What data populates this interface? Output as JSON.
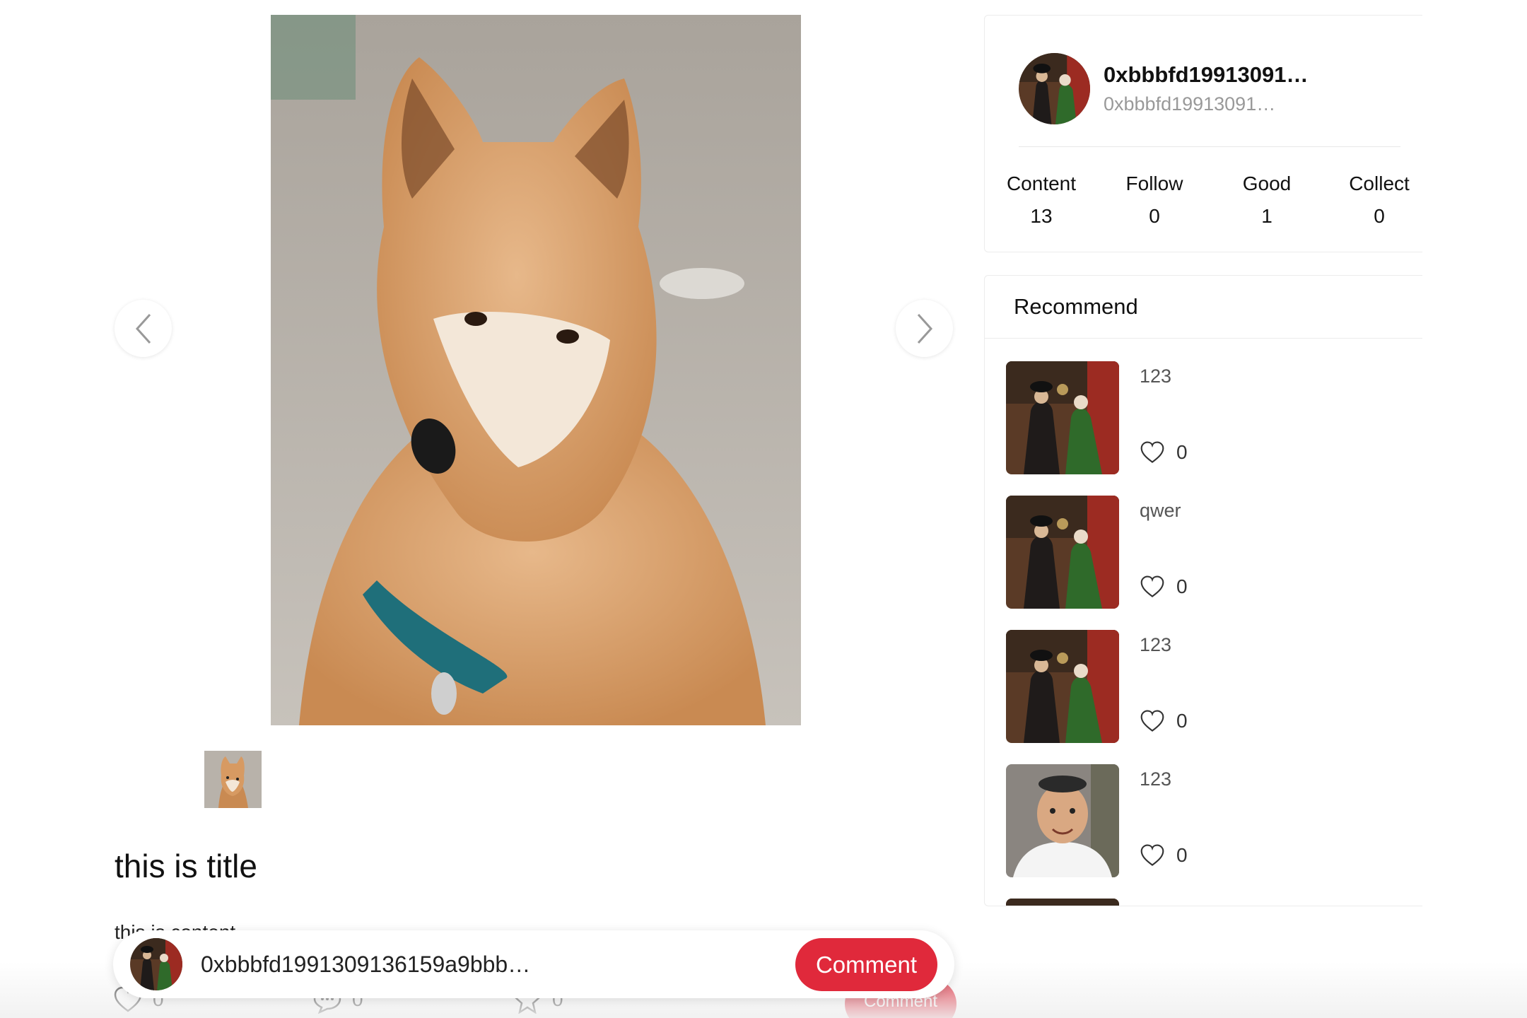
{
  "post": {
    "title": "this is title",
    "body": "this is content",
    "image_alt": "shiba-inu-photo"
  },
  "carousel": {
    "prev_icon": "chevron-left-icon",
    "next_icon": "chevron-right-icon"
  },
  "actions": {
    "likes": "0",
    "comments": "0",
    "collects": "0",
    "comment_label": "Comment"
  },
  "comment_bar": {
    "address": "0xbbbfd1991309136159a9bbb…",
    "button_label": "Comment"
  },
  "profile": {
    "name": "0xbbbfd19913091…",
    "sub": "0xbbbfd19913091…",
    "stats": [
      {
        "label": "Content",
        "value": "13"
      },
      {
        "label": "Follow",
        "value": "0"
      },
      {
        "label": "Good",
        "value": "1"
      },
      {
        "label": "Collect",
        "value": "0"
      }
    ]
  },
  "recommend": {
    "heading": "Recommend",
    "items": [
      {
        "title": "123",
        "likes": "0",
        "image": "painting"
      },
      {
        "title": "qwer",
        "likes": "0",
        "image": "painting"
      },
      {
        "title": "123",
        "likes": "0",
        "image": "painting"
      },
      {
        "title": "123",
        "likes": "0",
        "image": "man-portrait"
      }
    ]
  },
  "colors": {
    "accent": "#e0293b",
    "border": "#ececec",
    "muted_text": "#999999"
  }
}
